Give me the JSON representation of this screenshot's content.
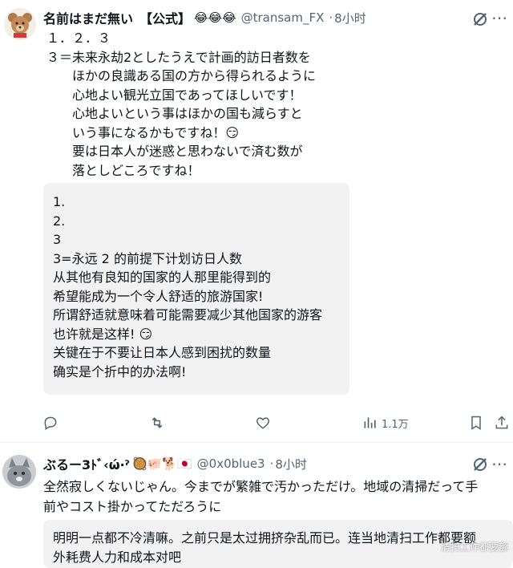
{
  "post1": {
    "name": "名前はまだ無い　【公式】",
    "name_emojis": "😂😂😂",
    "handle": "@transam_FX",
    "time": "8小时",
    "body": "１．２．３\n３＝未来永劫2としたうえで計画的訪日者数を\n　　ほかの良識ある国の方から得られるように\n　　心地よい観光立国であってほしいです！\n　　心地よいという事はほかの国も減らすと\n　　いう事になるかもですね！😏\n　　要は日本人が迷惑と思わないで済む数が\n　　落としどころですね！",
    "translation": "1.\n2.\n3\n3=永远 2 的前提下计划访日人数\n从其他有良知的国家的人那里能得到的\n希望能成为一个令人舒适的旅游国家!\n所谓舒适就意味着可能需要减少其他国家的游客\n也许就是这样! 😏\n关键在于不要让日本人感到困扰的数量\n确实是个折中的办法啊!",
    "views": "1.1万"
  },
  "post2": {
    "name": "ぶるー3ﾄﾞ‹ώ·ˀ",
    "name_emojis": "🥘🐖🐕🇯🇵",
    "handle": "@0x0blue3",
    "time": "8小时",
    "body": "全然寂しくないじゃん。今までが繁雑で汚かっただけ。地域の清掃だって手\n前やコスト掛かってただろうに",
    "translation": "明明一点都不冷清嘛。之前只是太过拥挤杂乱而已。连当地清扫工作都要额\n外耗费人力和成本对吧"
  },
  "watermark": "清扫工作都要额"
}
